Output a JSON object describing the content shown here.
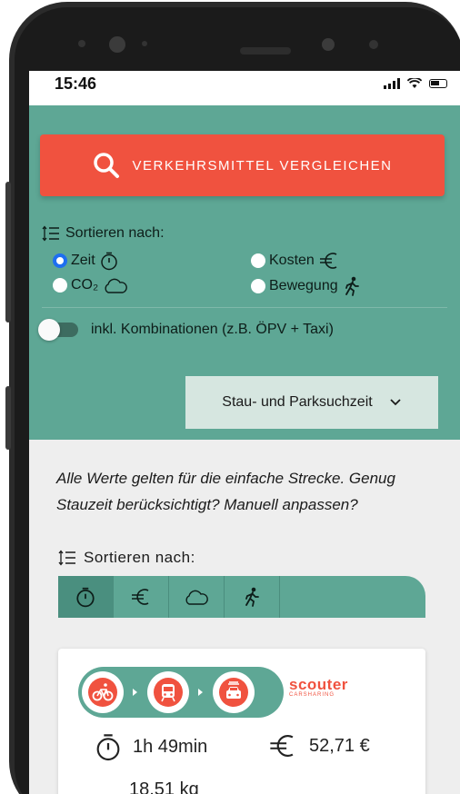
{
  "status_bar": {
    "time": "15:46"
  },
  "compare_button": {
    "label": "VERKEHRSMITTEL VERGLEICHEN",
    "icon": "search-icon"
  },
  "sort": {
    "heading": "Sortieren nach:",
    "options": [
      {
        "label": "Zeit",
        "icon": "stopwatch-icon",
        "selected": true
      },
      {
        "label": "Kosten",
        "icon": "euro-icon",
        "selected": false
      },
      {
        "label": "CO₂",
        "icon": "cloud-icon",
        "selected": false
      },
      {
        "label": "Bewegung",
        "icon": "walking-icon",
        "selected": false
      }
    ]
  },
  "combinations_toggle": {
    "label": "inkl. Kombinationen (z.B. ÖPV + Taxi)",
    "on": false
  },
  "dropdown": {
    "label": "Stau- und Parksuchzeit"
  },
  "info": {
    "text": "Alle Werte gelten für die einfache Strecke. Genug Stauzeit berücksichtigt? Manuell anpassen?"
  },
  "sort_bar": {
    "heading": "Sortieren nach:",
    "tabs": [
      "stopwatch-icon",
      "euro-icon",
      "cloud-icon",
      "walking-icon"
    ],
    "active": 0
  },
  "result": {
    "modes": [
      "bicycle-icon",
      "train-icon",
      "car-icon"
    ],
    "provider_name": "scouter",
    "provider_sub": "CARSHARING",
    "duration": "1h 49min",
    "cost": "52,71 €",
    "co2": "18,51 kg"
  },
  "colors": {
    "teal": "#5ea795",
    "red": "#f0523f",
    "radio_blue": "#1e6ff0"
  }
}
